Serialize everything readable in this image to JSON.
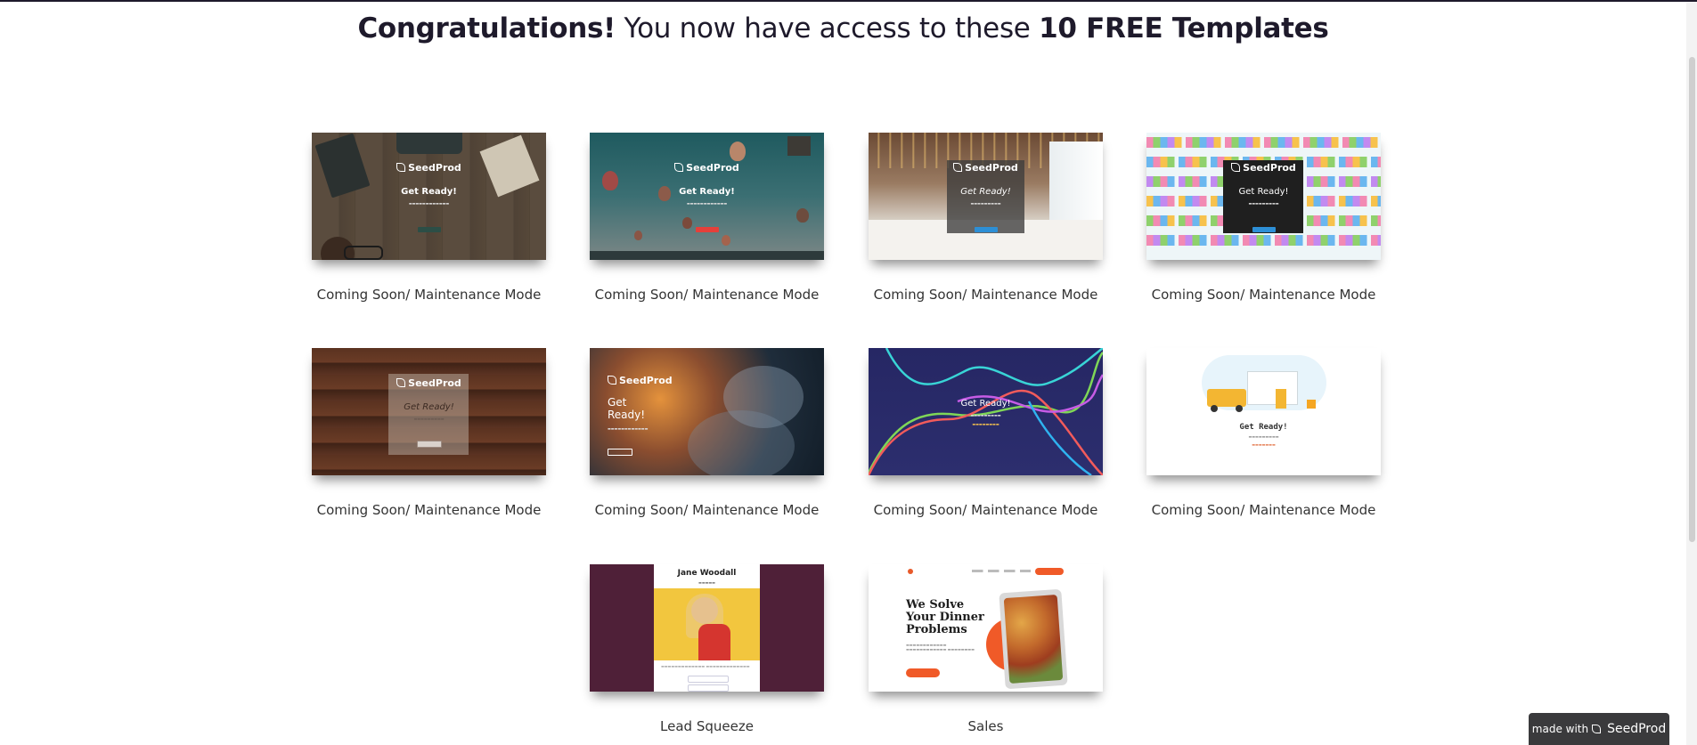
{
  "headline": {
    "strong1": "Congratulations!",
    "middle": " You now have access to these ",
    "strong2": "10 FREE Templates"
  },
  "templates": [
    {
      "label": "Coming Soon/ Maintenance Mode",
      "logo": "SeedProd",
      "heading": "Get Ready!"
    },
    {
      "label": "Coming Soon/ Maintenance Mode",
      "logo": "SeedProd",
      "heading": "Get Ready!"
    },
    {
      "label": "Coming Soon/ Maintenance Mode",
      "logo": "SeedProd",
      "heading": "Get Ready!"
    },
    {
      "label": "Coming Soon/ Maintenance Mode",
      "logo": "SeedProd",
      "heading": "Get Ready!"
    },
    {
      "label": "Coming Soon/ Maintenance Mode",
      "logo": "SeedProd",
      "heading": "Get Ready!"
    },
    {
      "label": "Coming Soon/ Maintenance Mode",
      "logo": "SeedProd",
      "heading": "Get\nReady!"
    },
    {
      "label": "Coming Soon/ Maintenance Mode",
      "heading": "Get Ready!"
    },
    {
      "label": "Coming Soon/ Maintenance Mode",
      "heading": "Get Ready!"
    },
    {
      "label": "Lead Squeeze",
      "heading": "Jane Woodall"
    },
    {
      "label": "Sales",
      "heading": "We Solve Your Dinner Problems"
    }
  ],
  "badge": {
    "prefix": "made with",
    "brand": "SeedProd"
  },
  "colors": {
    "accent": "#e5403a",
    "button_blue": "#2d8fd6",
    "sales_orange": "#f05a28",
    "lead_bg": "#4f2038"
  }
}
